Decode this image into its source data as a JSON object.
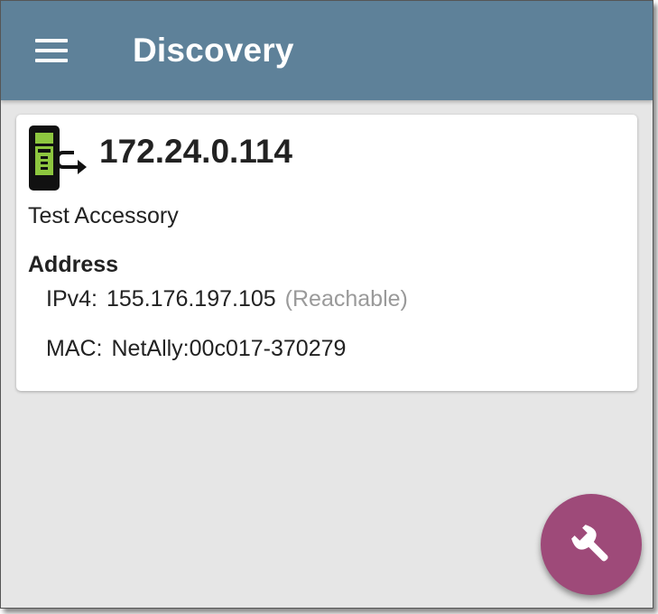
{
  "appbar": {
    "title": "Discovery",
    "menu_icon": "hamburger-menu-icon"
  },
  "device": {
    "icon": "test-accessory-device-icon",
    "ip": "172.24.0.114",
    "type": "Test Accessory",
    "address_heading": "Address",
    "ipv4_label": "IPv4:",
    "ipv4_value": "155.176.197.105",
    "ipv4_status": "(Reachable)",
    "mac_label": "MAC:",
    "mac_value": "NetAlly:00c017-370279"
  },
  "fab": {
    "icon": "wrench-icon"
  },
  "colors": {
    "appbar": "#5e8199",
    "background": "#e6e6e6",
    "fab": "#9e4a79",
    "status_text": "#9a9a9a"
  }
}
